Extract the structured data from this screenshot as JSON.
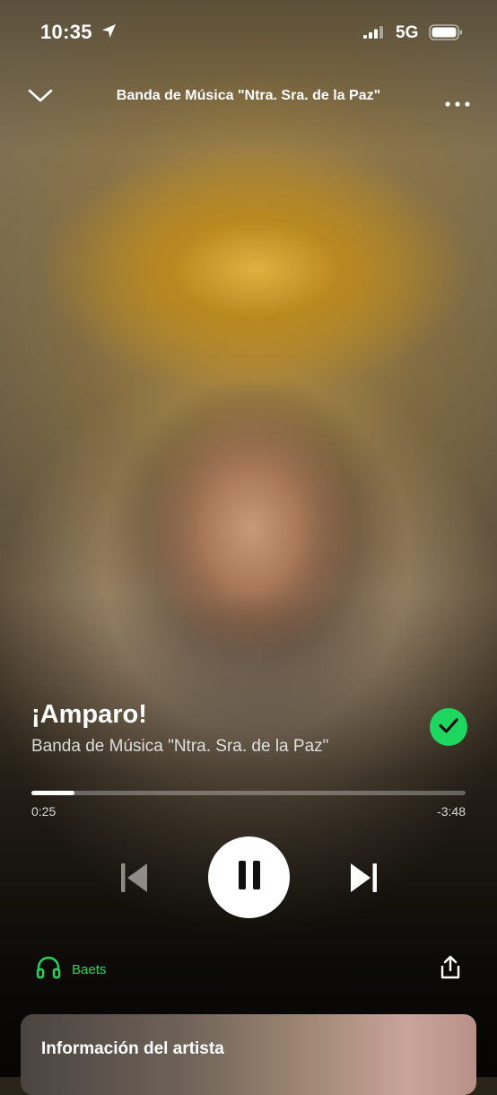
{
  "status_bar": {
    "time": "10:35",
    "network": "5G"
  },
  "header": {
    "title": "Banda de Música \"Ntra. Sra. de la Paz\""
  },
  "track": {
    "title": "¡Amparo!",
    "artist": "Banda de Música \"Ntra. Sra. de la Paz\"",
    "liked": true
  },
  "playback": {
    "elapsed": "0:25",
    "remaining": "-3:48",
    "progress_fraction": 0.1,
    "state": "playing"
  },
  "device": {
    "label": "Baets"
  },
  "artist_card": {
    "title": "Información del artista"
  },
  "colors": {
    "accent": "#1ed760",
    "text": "#ffffff"
  },
  "icons": {
    "location": "location-arrow-icon",
    "signal": "signal-icon",
    "battery": "battery-icon",
    "collapse": "chevron-down-icon",
    "more": "more-icon",
    "liked": "check-icon",
    "previous": "previous-icon",
    "pause": "pause-icon",
    "next": "next-icon",
    "device": "headphones-icon",
    "share": "share-icon"
  }
}
